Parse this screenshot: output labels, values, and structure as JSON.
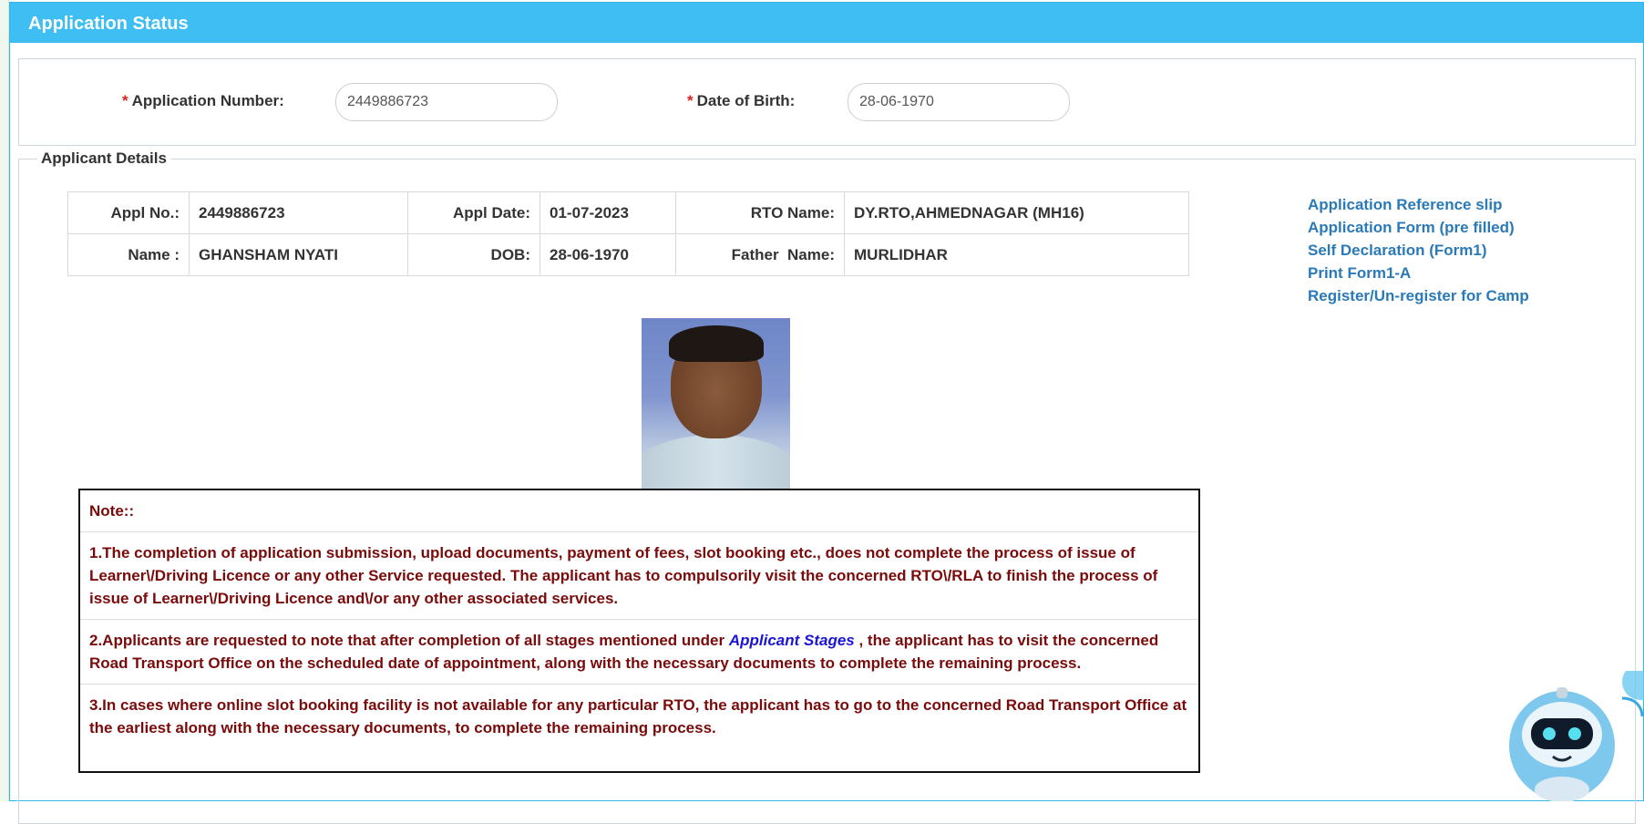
{
  "header": {
    "title": "Application Status"
  },
  "search": {
    "application_number_label": "Application Number:",
    "application_number_value": "2449886723",
    "dob_label": "Date of Birth:",
    "dob_value": "28-06-1970",
    "required_mark": "*"
  },
  "details": {
    "legend": "Applicant Details",
    "appl_no_label": "Appl No.:",
    "appl_no": "2449886723",
    "appl_date_label": "Appl Date:",
    "appl_date": "01-07-2023",
    "rto_label": "RTO Name:",
    "rto_name": "DY.RTO,AHMEDNAGAR (MH16)",
    "name_label": "Name :",
    "name": "GHANSHAM NYATI",
    "dob_label": "DOB:",
    "dob": "28-06-1970",
    "father_label": "Father  Name:",
    "father_name": "MURLIDHAR"
  },
  "links": [
    "Application Reference slip",
    "Application Form (pre filled)",
    "Self Declaration (Form1)",
    "Print Form1-A",
    "Register/Un-register for Camp"
  ],
  "note": {
    "title": "Note::",
    "item1": "1.The completion of application submission, upload documents, payment of fees, slot booking etc., does not complete the process of issue of Learner\\/Driving Licence or any other Service requested. The applicant has to compulsorily visit the concerned RTO\\/RLA to finish the process of issue of Learner\\/Driving Licence and\\/or any other associated services.",
    "item2_pre": "2.Applicants are requested to note that after completion of all stages mentioned under ",
    "item2_link": "Applicant Stages",
    "item2_post": " , the applicant has to visit the concerned Road Transport Office on the scheduled date of appointment, along with the necessary documents to complete the remaining process.",
    "item3": "3.In cases where online slot booking facility is not available for any particular RTO, the applicant has to go to the concerned Road Transport Office at the earliest along with the necessary documents, to complete the remaining process."
  },
  "colors": {
    "header_bg": "#3ebef2",
    "link": "#2a7ab8",
    "note_text": "#7a0b0b",
    "required": "#d9231d"
  }
}
